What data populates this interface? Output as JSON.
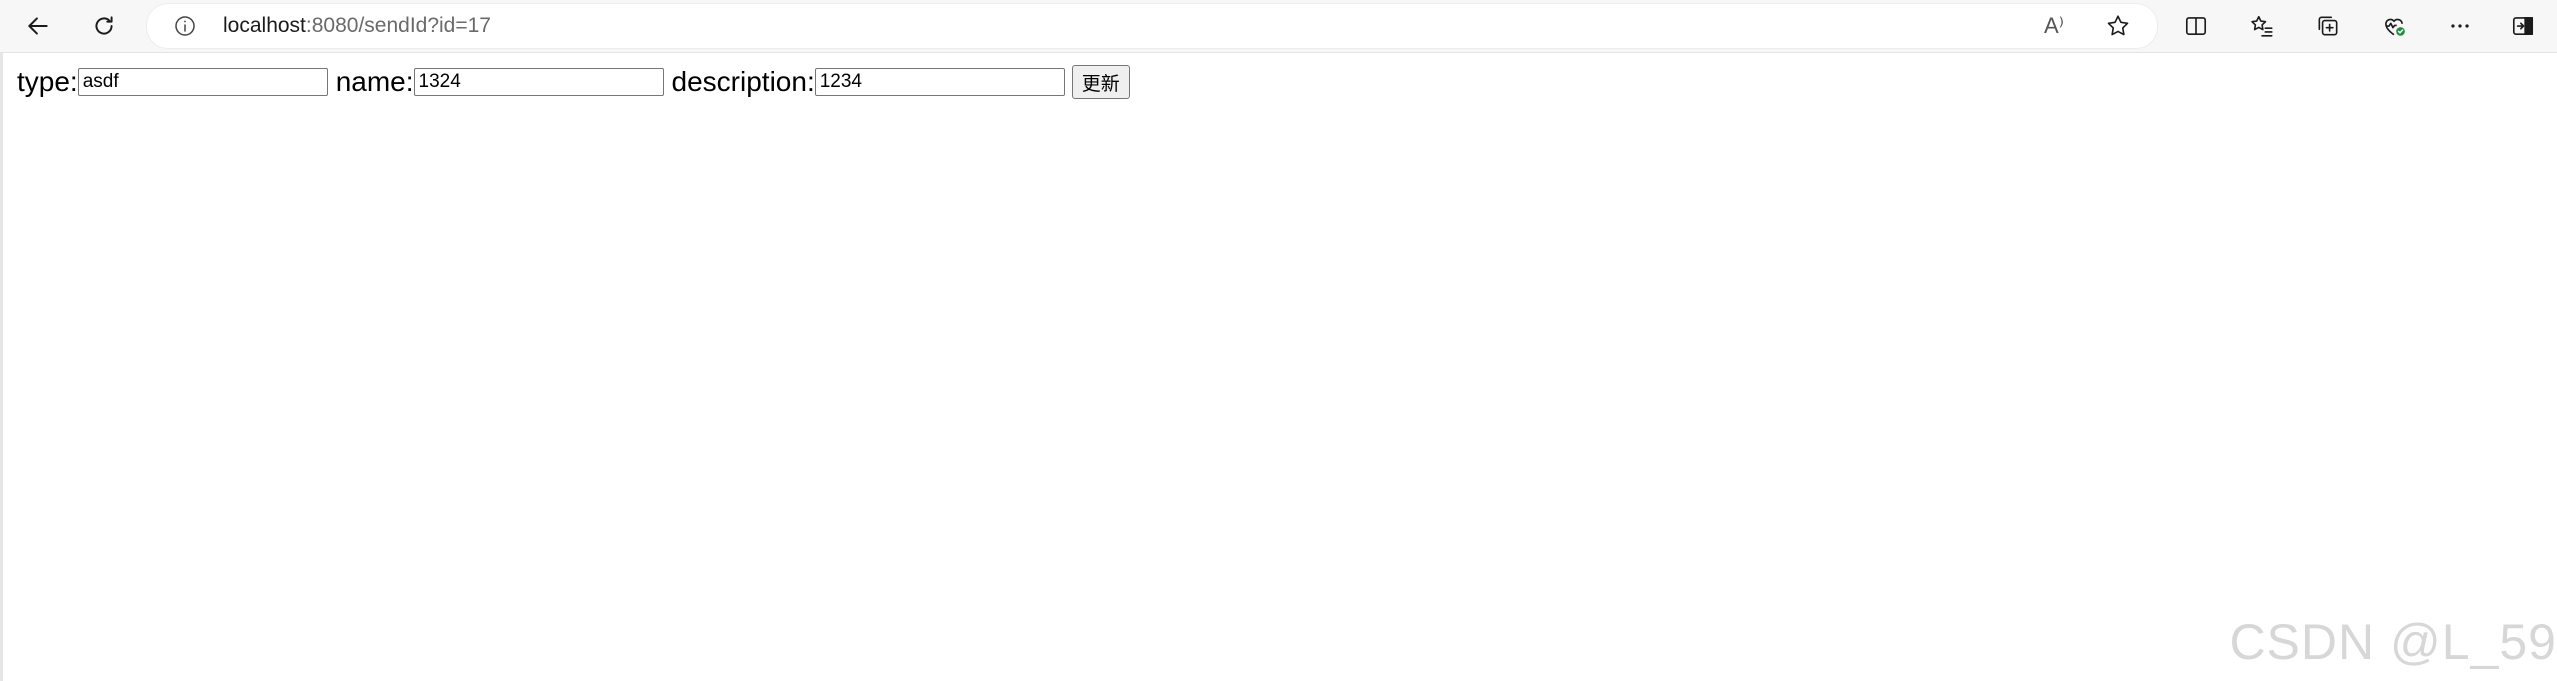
{
  "browser": {
    "url_host": "localhost",
    "url_rest": ":8080/sendId?id=17",
    "read_aloud_glyph": "A⁾"
  },
  "form": {
    "type_label": "type:",
    "type_value": "asdf",
    "name_label": "name:",
    "name_value": "1324",
    "description_label": "description:",
    "description_value": "1234",
    "submit_label": "更新"
  },
  "watermark": "CSDN @L_59",
  "colors": {
    "toolbar_bg": "#f7f7f7",
    "address_bg": "#ffffff",
    "icon": "#1b1b1b",
    "health_badge": "#1e8e3e"
  }
}
